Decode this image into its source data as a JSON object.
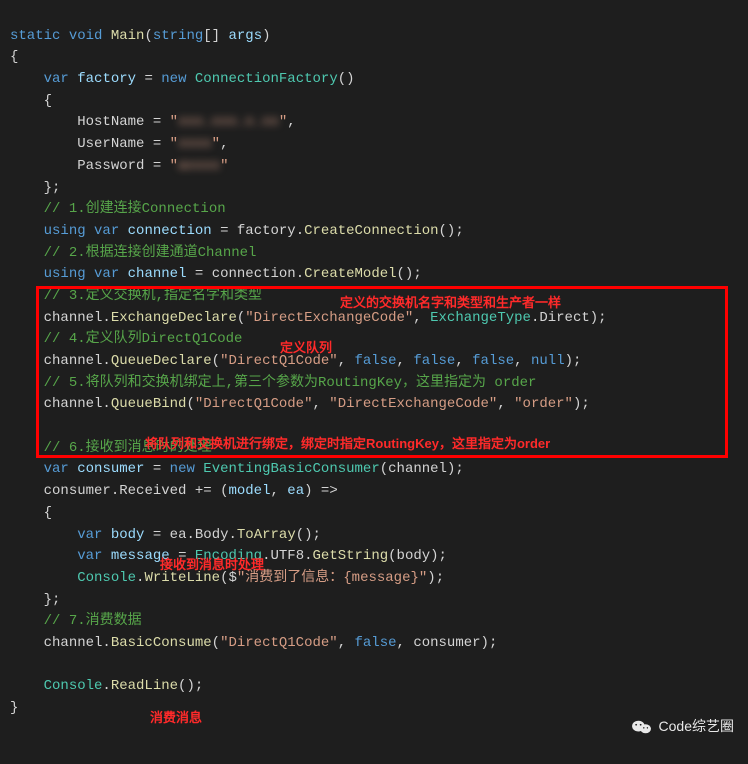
{
  "code": {
    "sig_static": "static",
    "sig_void": "void",
    "sig_main": "Main",
    "sig_string": "string",
    "sig_args": "args",
    "var_kw": "var",
    "new_kw": "new",
    "using_kw": "using",
    "false_kw": "false",
    "null_kw": "null",
    "factory": "factory",
    "ConnectionFactory": "ConnectionFactory",
    "HostName": "HostName",
    "UserName": "UserName",
    "Password": "Password",
    "host_blur": "xxx.xxx.x.xx",
    "user_blur": "xxxx",
    "pass_blur": "axxxx",
    "cmt1": "// 1.创建连接Connection",
    "connection": "connection",
    "CreateConnection": "CreateConnection",
    "cmt2": "// 2.根据连接创建通道Channel",
    "channel": "channel",
    "CreateModel": "CreateModel",
    "cmt3": "// 3.定义交换机,指定名字和类型",
    "ExchangeDeclare": "ExchangeDeclare",
    "DirectExchangeCode": "\"DirectExchangeCode\"",
    "ExchangeType": "ExchangeType",
    "Direct": "Direct",
    "cmt4": "// 4.定义队列DirectQ1Code",
    "QueueDeclare": "QueueDeclare",
    "DirectQ1Code": "\"DirectQ1Code\"",
    "cmt5": "// 5.将队列和交换机绑定上,第三个参数为RoutingKey，这里指定为 order",
    "QueueBind": "QueueBind",
    "order": "\"order\"",
    "cmt6": "// 6.接收到消息时的处理",
    "consumer": "consumer",
    "EventingBasicConsumer": "EventingBasicConsumer",
    "Received": "Received",
    "model": "model",
    "ea": "ea",
    "body": "body",
    "Body": "Body",
    "ToArray": "ToArray",
    "message": "message",
    "Encoding": "Encoding",
    "UTF8": "UTF8",
    "GetString": "GetString",
    "Console": "Console",
    "WriteLine": "WriteLine",
    "consume_msg": "\"消费到了信息：{message}\"",
    "cmt7": "// 7.消费数据",
    "BasicConsume": "BasicConsume",
    "ReadLine": "ReadLine"
  },
  "annotations": {
    "a1": "定义的交换机名字和类型和生产者一样",
    "a2": "定义队列",
    "a3": "将队列和交换机进行绑定，绑定时指定RoutingKey，这里指定为order",
    "a4": "接收到消息时处理",
    "a5": "消费消息"
  },
  "watermark": "Code综艺圈"
}
